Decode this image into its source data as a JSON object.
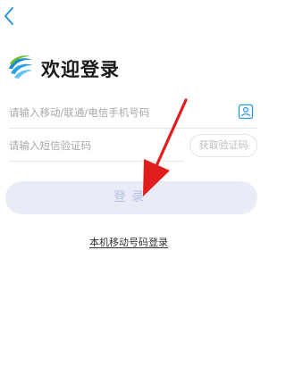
{
  "header": {
    "back_icon": "chevron-left-icon"
  },
  "brand": {
    "logo_icon": "china-mobile-logo-icon",
    "title": "欢迎登录"
  },
  "phone": {
    "placeholder": "请输入移动/联通/电信手机号码",
    "contact_icon": "contact-book-icon"
  },
  "code": {
    "placeholder": "请输入短信验证码",
    "get_code_label": "获取验证码"
  },
  "login": {
    "label": "登录"
  },
  "alt_login": {
    "label": "本机移动号码登录"
  },
  "colors": {
    "accent": "#2a96e0",
    "login_bg": "#e9ecf7",
    "annotation_arrow": "#e21d1d"
  }
}
